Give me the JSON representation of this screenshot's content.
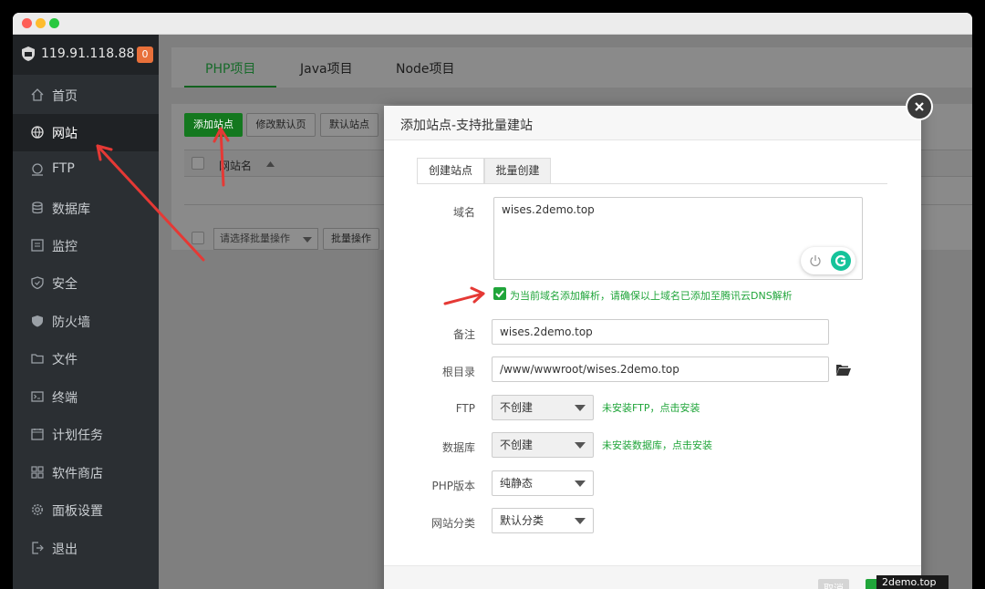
{
  "server": {
    "ip": "119.91.118.88",
    "badge": "0"
  },
  "sidebar": {
    "items": [
      {
        "label": "首页",
        "icon": "home-icon"
      },
      {
        "label": "网站",
        "icon": "globe-icon",
        "active": true
      },
      {
        "label": "FTP",
        "icon": "ftp-icon"
      },
      {
        "label": "数据库",
        "icon": "database-icon"
      },
      {
        "label": "监控",
        "icon": "monitor-icon"
      },
      {
        "label": "安全",
        "icon": "shield-check-icon"
      },
      {
        "label": "防火墙",
        "icon": "firewall-icon"
      },
      {
        "label": "文件",
        "icon": "folder-icon"
      },
      {
        "label": "终端",
        "icon": "terminal-icon"
      },
      {
        "label": "计划任务",
        "icon": "calendar-icon"
      },
      {
        "label": "软件商店",
        "icon": "apps-icon"
      },
      {
        "label": "面板设置",
        "icon": "gear-icon"
      },
      {
        "label": "退出",
        "icon": "logout-icon"
      }
    ]
  },
  "project_tabs": [
    "PHP项目",
    "Java项目",
    "Node项目"
  ],
  "toolbar": {
    "add_site": "添加站点",
    "edit_default_page": "修改默认页",
    "default_site": "默认站点"
  },
  "table": {
    "col_site_name": "网站名"
  },
  "batch": {
    "select_placeholder": "请选择批量操作",
    "button": "批量操作"
  },
  "dialog": {
    "title": "添加站点-支持批量建站",
    "tabs": [
      "创建站点",
      "批量创建"
    ],
    "domain_label": "域名",
    "domain_value": "wises.2demo.top",
    "dns_check_text": "为当前域名添加解析，请确保以上域名已添加至腾讯云DNS解析",
    "remark_label": "备注",
    "remark_value": "wises.2demo.top",
    "root_label": "根目录",
    "root_value": "/www/wwwroot/wises.2demo.top",
    "ftp_label": "FTP",
    "ftp_value": "不创建",
    "ftp_hint": "未安装FTP，点击安装",
    "db_label": "数据库",
    "db_value": "不创建",
    "db_hint": "未安装数据库，点击安装",
    "php_label": "PHP版本",
    "php_value": "纯静态",
    "category_label": "网站分类",
    "category_value": "默认分类",
    "cancel_label": "取消"
  },
  "tooltip": "2demo.top",
  "colors": {
    "accent_green": "#20a53a",
    "sidebar_bg": "#2b2f33",
    "annotation_red": "#e53935"
  }
}
